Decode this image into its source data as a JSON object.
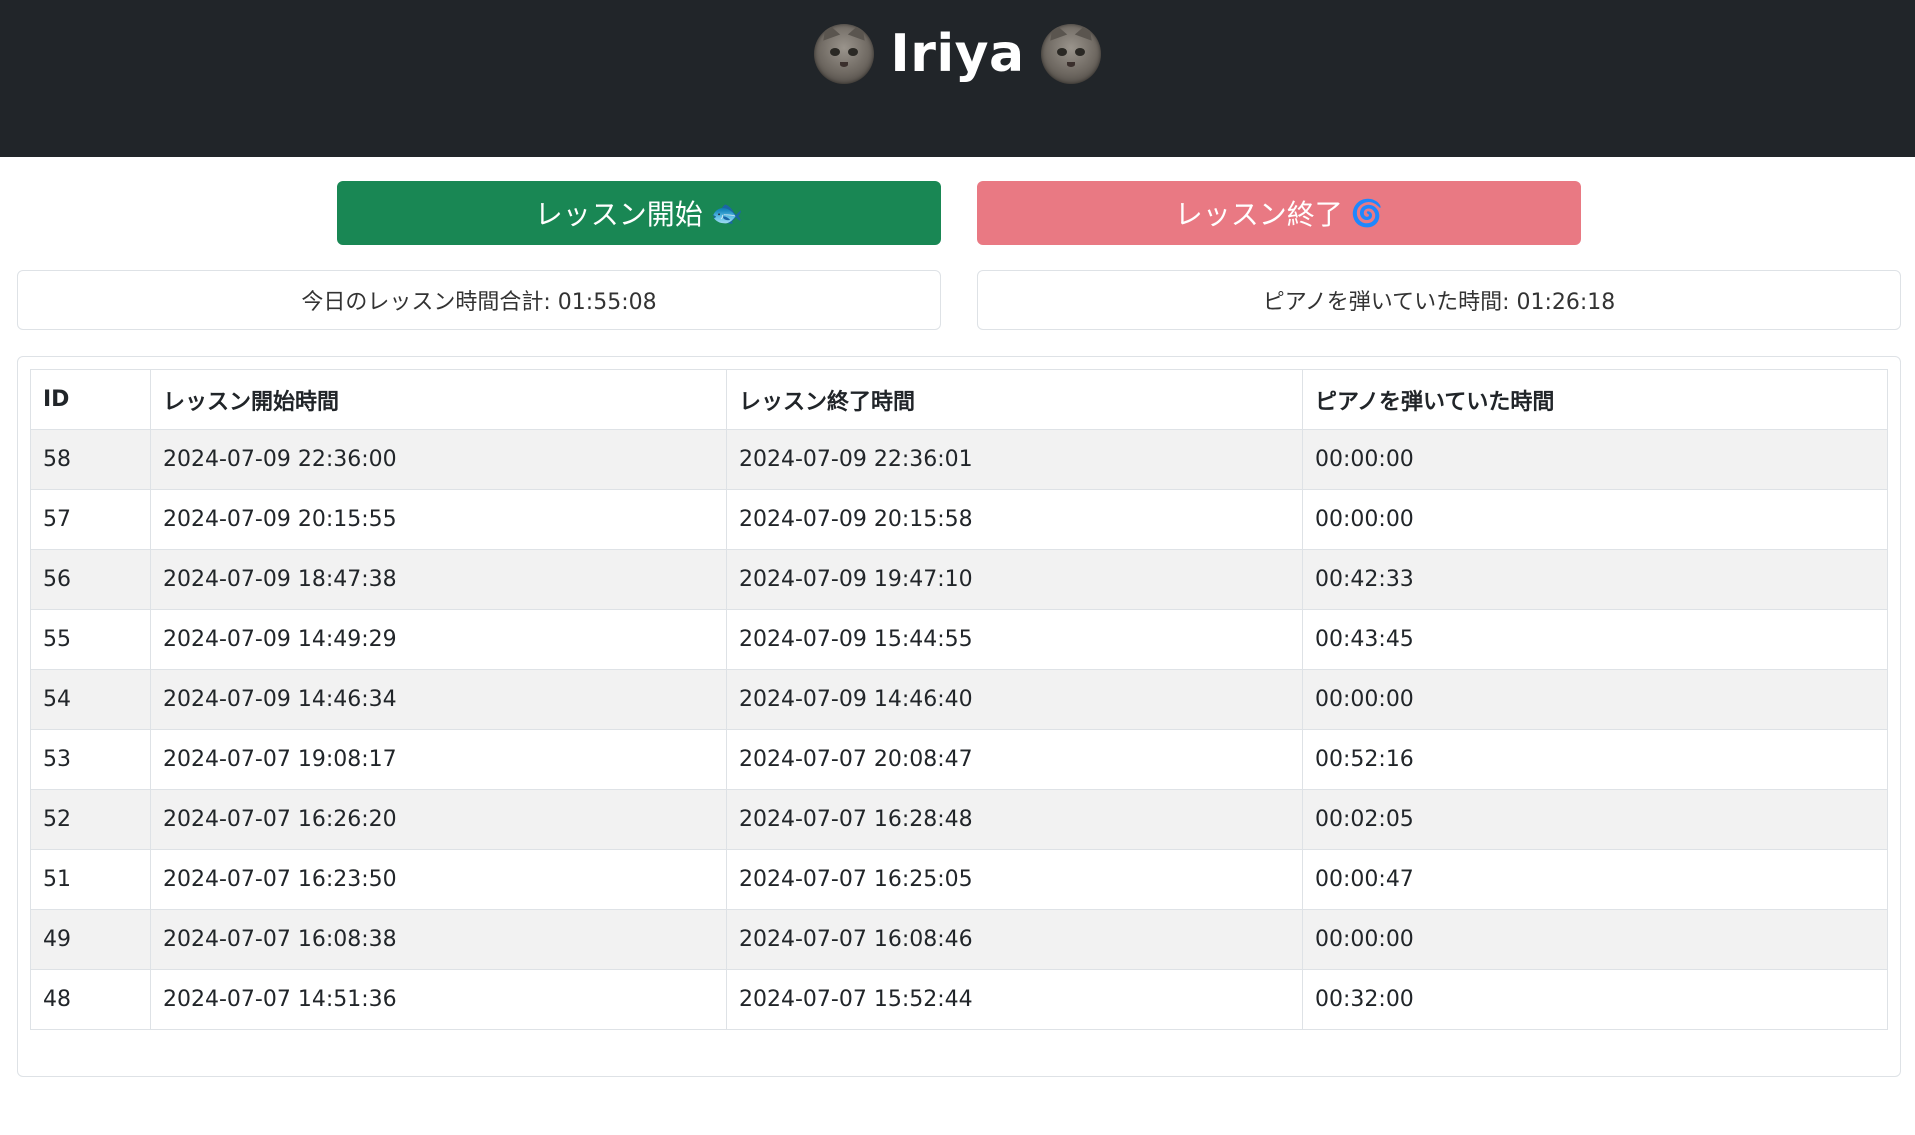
{
  "header": {
    "title": "Iriya",
    "left_icon": "cat-photo-icon",
    "right_icon": "cat-photo-icon",
    "background": "#212529"
  },
  "controls": {
    "start_label": "レッスン開始",
    "start_icon": "🐟",
    "start_color": "#198754",
    "end_label": "レッスン終了",
    "end_icon": "🌀",
    "end_color": "#e97983"
  },
  "stats": {
    "today_total": "今日のレッスン時間合計: 01:55:08",
    "piano_time": "ピアノを弾いていた時間: 01:26:18"
  },
  "table": {
    "columns": [
      "ID",
      "レッスン開始時間",
      "レッスン終了時間",
      "ピアノを弾いていた時間"
    ],
    "rows": [
      [
        "58",
        "2024-07-09 22:36:00",
        "2024-07-09 22:36:01",
        "00:00:00"
      ],
      [
        "57",
        "2024-07-09 20:15:55",
        "2024-07-09 20:15:58",
        "00:00:00"
      ],
      [
        "56",
        "2024-07-09 18:47:38",
        "2024-07-09 19:47:10",
        "00:42:33"
      ],
      [
        "55",
        "2024-07-09 14:49:29",
        "2024-07-09 15:44:55",
        "00:43:45"
      ],
      [
        "54",
        "2024-07-09 14:46:34",
        "2024-07-09 14:46:40",
        "00:00:00"
      ],
      [
        "53",
        "2024-07-07 19:08:17",
        "2024-07-07 20:08:47",
        "00:52:16"
      ],
      [
        "52",
        "2024-07-07 16:26:20",
        "2024-07-07 16:28:48",
        "00:02:05"
      ],
      [
        "51",
        "2024-07-07 16:23:50",
        "2024-07-07 16:25:05",
        "00:00:47"
      ],
      [
        "49",
        "2024-07-07 16:08:38",
        "2024-07-07 16:08:46",
        "00:00:00"
      ],
      [
        "48",
        "2024-07-07 14:51:36",
        "2024-07-07 15:52:44",
        "00:32:00"
      ]
    ]
  }
}
